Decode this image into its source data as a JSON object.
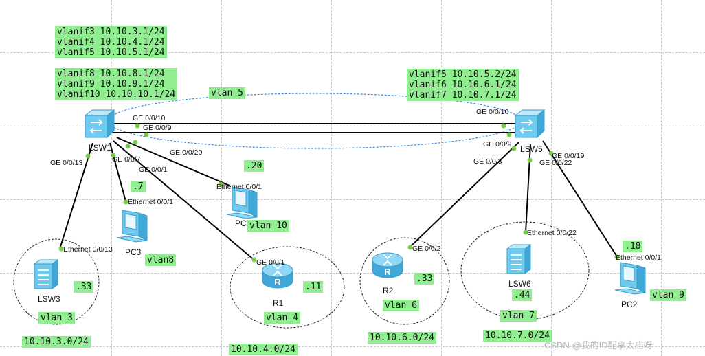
{
  "vlanif_groups": {
    "lsw1_a": [
      "vlanif3 10.10.3.1/24",
      "vlanif4 10.10.4.1/24",
      "vlanif5 10.10.5.1/24"
    ],
    "lsw1_b": [
      "vlanif8 10.10.8.1/24",
      "vlanif9 10.10.9.1/24",
      "vlanif10 10.10.10.1/24"
    ],
    "lsw5": [
      "vlanif5 10.10.5.2/24",
      "vlanif6 10.10.6.1/24",
      "vlanif7 10.10.7.1/24"
    ]
  },
  "trunk_vlan": "vlan 5",
  "devices": {
    "lsw1": "LSW1",
    "lsw5": "LSW5",
    "lsw3": "LSW3",
    "lsw6": "LSW6",
    "pc1": "PC1",
    "pc2": "PC2",
    "pc3": "PC3",
    "r1": "R1",
    "r2": "R2"
  },
  "ports": {
    "lsw1_ge10": "GE 0/0/10",
    "lsw1_ge9": "GE 0/0/9",
    "lsw1_ge13": "GE 0/0/13",
    "lsw1_ge7": "GE 0/0/7",
    "lsw1_ge1": "GE 0/0/1",
    "lsw1_ge20": "GE 0/0/20",
    "lsw5_ge10": "GE 0/0/10",
    "lsw5_ge9": "GE 0/0/9",
    "lsw5_ge3": "GE 0/0/3",
    "lsw5_ge22": "GE 0/0/22",
    "lsw5_ge19": "GE 0/0/19",
    "lsw3_eth13": "Ethernet 0/0/13",
    "pc3_eth1": "Ethernet 0/0/1",
    "pc1_eth1": "Ethernet 0/0/1",
    "r1_ge1": "GE 0/0/1",
    "r2_ge2": "GE 0/0/2",
    "lsw6_eth22": "Ethernet 0/0/22",
    "pc2_eth1": "Ethernet 0/0/1"
  },
  "host_ips": {
    "pc3": ".7",
    "pc1": ".20",
    "lsw3": ".33",
    "r1": ".11",
    "r2": ".33",
    "lsw6": ".44",
    "pc2": ".18"
  },
  "vlans": {
    "pc1": "vlan 10",
    "pc3": "vlan8",
    "lsw3": "vlan 3",
    "r1": "vlan 4",
    "r2": "vlan 6",
    "lsw6": "vlan 7",
    "pc2": "vlan 9"
  },
  "subnets": {
    "lsw3": "10.10.3.0/24",
    "r1": "10.10.4.0/24",
    "r2": "10.10.6.0/24",
    "lsw6": "10.10.7.0/24"
  },
  "colors": {
    "label_bg": "#90ee90",
    "link": "#000000",
    "vlan_oval": "#3a8ee6",
    "port_dot": "#7ac943",
    "grid": "#c8c8c8",
    "device": "#4fb8e8"
  },
  "watermark": "CSDN @我的ID配享太庙呀"
}
